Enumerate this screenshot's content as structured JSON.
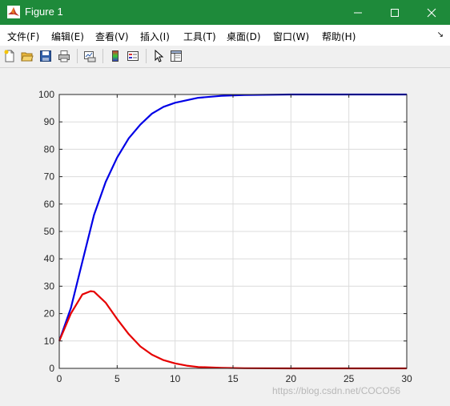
{
  "window": {
    "title": "Figure 1",
    "accent": "#1e8a3a"
  },
  "menu": {
    "items": [
      "文件(F)",
      "编辑(E)",
      "查看(V)",
      "插入(I)",
      "工具(T)",
      "桌面(D)",
      "窗口(W)",
      "帮助(H)"
    ],
    "more": "↘"
  },
  "toolbar": {
    "icons": [
      "new-figure-icon",
      "open-file-icon",
      "save-icon",
      "print-icon",
      "link-plot-icon",
      "colorbar-icon",
      "legend-icon",
      "pointer-icon",
      "property-editor-icon"
    ]
  },
  "watermark": "https://blog.csdn.net/COCO56",
  "chart_data": {
    "type": "line",
    "xlim": [
      0,
      30
    ],
    "ylim": [
      0,
      100
    ],
    "xticks": [
      0,
      5,
      10,
      15,
      20,
      25,
      30
    ],
    "yticks": [
      0,
      10,
      20,
      30,
      40,
      50,
      60,
      70,
      80,
      90,
      100
    ],
    "grid": true,
    "series": [
      {
        "color": "#0000e6",
        "x": [
          0,
          1,
          2,
          3,
          4,
          5,
          6,
          7,
          8,
          9,
          10,
          12,
          14,
          16,
          20,
          25,
          30
        ],
        "y": [
          10,
          22,
          39,
          56,
          68,
          77,
          84,
          89,
          93,
          95.5,
          97,
          98.8,
          99.5,
          99.8,
          100,
          100,
          100
        ]
      },
      {
        "color": "#e60000",
        "x": [
          0,
          1,
          2,
          2.7,
          3,
          4,
          5,
          6,
          7,
          8,
          9,
          10,
          11,
          12,
          14,
          16,
          20,
          30
        ],
        "y": [
          10,
          20,
          27,
          28.2,
          28,
          24,
          18,
          12.5,
          8,
          5,
          3,
          1.8,
          1,
          0.5,
          0.2,
          0.05,
          0,
          0
        ]
      }
    ]
  }
}
